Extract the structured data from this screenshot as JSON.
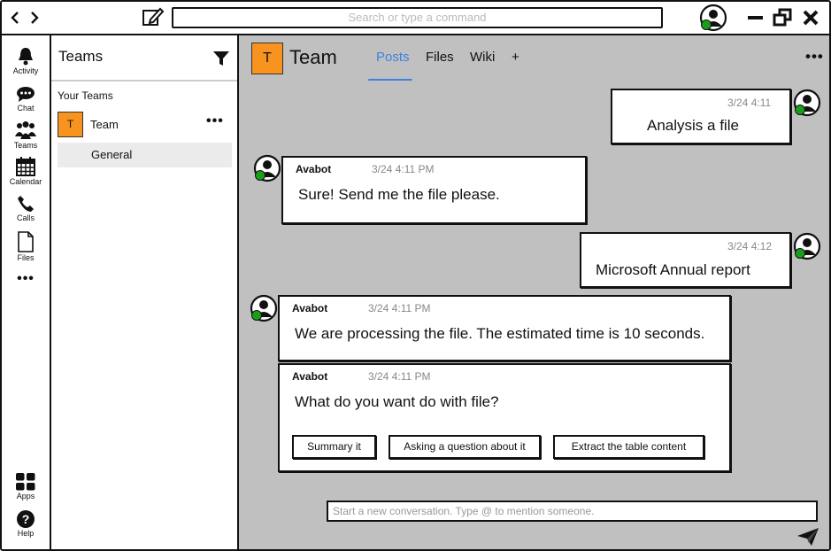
{
  "topbar": {
    "back_icon": "chevron-left-icon",
    "forward_icon": "chevron-right-icon",
    "search_placeholder": "Search or type a command"
  },
  "rail": {
    "items": [
      {
        "label": "Activity",
        "icon": "bell-icon"
      },
      {
        "label": "Chat",
        "icon": "chat-icon"
      },
      {
        "label": "Teams",
        "icon": "teams-icon"
      },
      {
        "label": "Calendar",
        "icon": "calendar-icon"
      },
      {
        "label": "Calls",
        "icon": "phone-icon"
      },
      {
        "label": "Files",
        "icon": "file-icon"
      },
      {
        "label": "Apps",
        "icon": "apps-icon"
      },
      {
        "label": "Help",
        "icon": "help-icon"
      }
    ]
  },
  "teams_panel": {
    "title": "Teams",
    "section": "Your Teams",
    "team": {
      "initial": "T",
      "name": "Team"
    },
    "channel": "General"
  },
  "main": {
    "team_initial": "T",
    "title": "Team",
    "tabs": [
      "Posts",
      "Files",
      "Wiki",
      "+"
    ],
    "active_tab": "Posts"
  },
  "messages": {
    "m1": {
      "time": "3/24 4:11",
      "text": "Analysis a file"
    },
    "m2": {
      "sender": "Avabot",
      "time": "3/24 4:11 PM",
      "text": "Sure! Send me the file please."
    },
    "m3": {
      "time": "3/24 4:12",
      "text": "Microsoft Annual report"
    },
    "m4": {
      "sender": "Avabot",
      "time": "3/24 4:11 PM",
      "text": "We are processing the file. The estimated time is 10 seconds."
    },
    "m5": {
      "sender": "Avabot",
      "time": "3/24 4:11 PM",
      "text": "What do you want do with file?",
      "actions": [
        "Summary it",
        "Asking a question about it",
        "Extract the table content"
      ]
    }
  },
  "composer": {
    "placeholder": "Start a new conversation.  Type @ to mention someone."
  },
  "colors": {
    "accent": "#3b83e0",
    "team_tile": "#f7931e",
    "presence": "#1a9e1a",
    "main_bg": "#c0c0c0"
  }
}
